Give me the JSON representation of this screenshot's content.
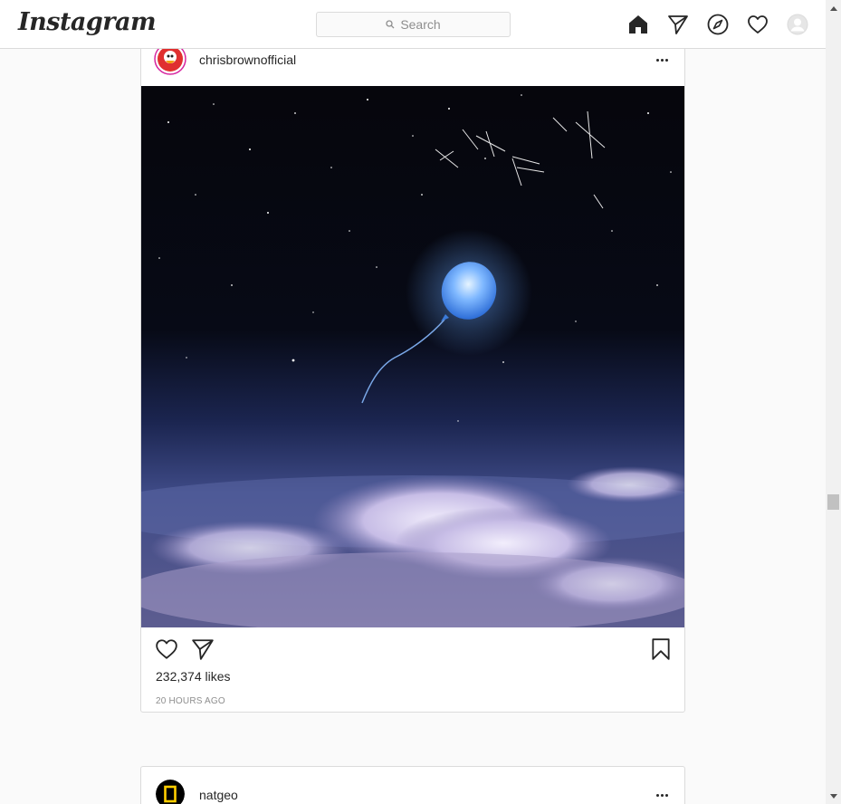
{
  "header": {
    "logo_text": "Instagram",
    "search_placeholder": "Search",
    "icons": [
      "home-icon",
      "direct-icon",
      "explore-icon",
      "activity-heart-icon",
      "profile-avatar"
    ]
  },
  "posts": [
    {
      "username": "chrisbrownofficial",
      "image_description_icon": "post-image",
      "likes": "232,374 likes",
      "timestamp": "20 HOURS AGO"
    },
    {
      "username": "natgeo"
    }
  ],
  "colors": {
    "border": "#dbdbdb",
    "background": "#fafafa",
    "text": "#262626",
    "muted": "#8e8e8e",
    "natgeo_yellow": "#ffce00"
  }
}
